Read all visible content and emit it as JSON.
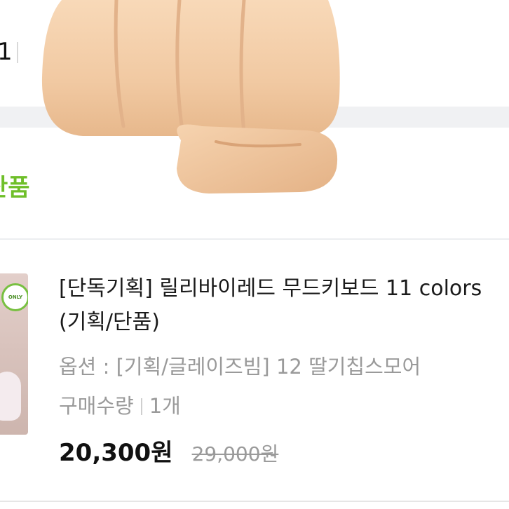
{
  "previous_item": {
    "count_partial": "1"
  },
  "section_label": "단품",
  "product": {
    "thumbnail_badge": "ONLY",
    "title": "[단독기획] 릴리바이레드 무드키보드 11 colors (기획/단품)",
    "option": "옵션 : [기획/글레이즈빔] 12 딸기칩스모어",
    "quantity_label": "구매수량",
    "quantity_value": "1개",
    "sale_price": "20,300원",
    "original_price": "29,000원"
  },
  "colors": {
    "accent_green": "#6fbf2a",
    "band_gray": "#f0f1f3",
    "muted_text": "#9a9a9a"
  },
  "overlay": {
    "icon": "fist-emoji-icon"
  }
}
